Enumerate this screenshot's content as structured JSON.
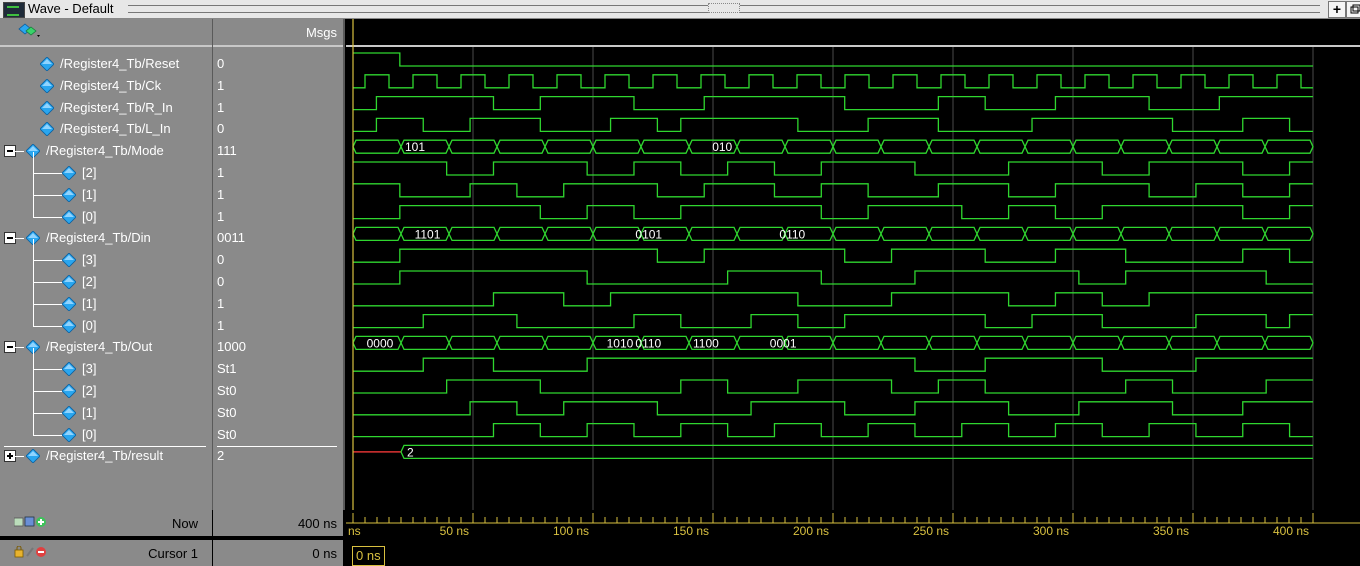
{
  "window": {
    "title": "Wave - Default",
    "buttons": [
      "+",
      ""
    ]
  },
  "header": {
    "msgs_label": "Msgs"
  },
  "signals": [
    {
      "name": "/Register4_Tb/Reset",
      "value": "0",
      "level": 0,
      "expand": null,
      "type": "bit",
      "wave": [
        1,
        1,
        0,
        0,
        0,
        0,
        0,
        0,
        0,
        0,
        0,
        0,
        0,
        0,
        0,
        0,
        0,
        0,
        0,
        0,
        0,
        0,
        0,
        0,
        0,
        0,
        0,
        0,
        0,
        0,
        0,
        0,
        0,
        0,
        0,
        0,
        0,
        0,
        0,
        0,
        0
      ]
    },
    {
      "name": "/Register4_Tb/Ck",
      "value": "1",
      "level": 0,
      "expand": null,
      "type": "clock"
    },
    {
      "name": "/Register4_Tb/R_In",
      "value": "1",
      "level": 0,
      "expand": null,
      "type": "bit",
      "wave": [
        0,
        1,
        1,
        1,
        1,
        1,
        0,
        0,
        1,
        1,
        1,
        1,
        0,
        0,
        0,
        1,
        1,
        1,
        1,
        1,
        1,
        0,
        0,
        0,
        0,
        1,
        1,
        0,
        0,
        0,
        1,
        1,
        1,
        1,
        0,
        0,
        0,
        1,
        1,
        1,
        1
      ]
    },
    {
      "name": "/Register4_Tb/L_In",
      "value": "0",
      "level": 0,
      "expand": null,
      "type": "bit",
      "wave": [
        0,
        1,
        1,
        0,
        0,
        1,
        1,
        1,
        0,
        0,
        0,
        1,
        1,
        0,
        1,
        1,
        1,
        1,
        1,
        0,
        0,
        0,
        1,
        1,
        1,
        0,
        0,
        0,
        0,
        1,
        1,
        1,
        1,
        1,
        1,
        0,
        0,
        0,
        1,
        1,
        0
      ]
    },
    {
      "name": "/Register4_Tb/Mode",
      "value": "111",
      "level": 0,
      "expand": "minus",
      "type": "bus",
      "labels": [
        {
          "at": 10,
          "text": "101"
        },
        {
          "at": 74,
          "text": "010"
        }
      ]
    },
    {
      "name": "[2]",
      "value": "1",
      "level": 1,
      "expand": null,
      "type": "bit",
      "wave": [
        1,
        1,
        1,
        1,
        0,
        0,
        1,
        1,
        1,
        1,
        0,
        0,
        1,
        1,
        0,
        0,
        1,
        1,
        0,
        0,
        1,
        1,
        1,
        1,
        0,
        0,
        0,
        0,
        1,
        1,
        1,
        1,
        0,
        0,
        1,
        1,
        1,
        1,
        0,
        0,
        1
      ]
    },
    {
      "name": "[1]",
      "value": "1",
      "level": 1,
      "expand": null,
      "type": "bit",
      "wave": [
        1,
        1,
        0,
        0,
        0,
        1,
        1,
        0,
        0,
        1,
        1,
        1,
        1,
        0,
        0,
        1,
        1,
        1,
        0,
        0,
        1,
        1,
        0,
        0,
        0,
        1,
        1,
        1,
        0,
        0,
        1,
        1,
        1,
        1,
        0,
        0,
        1,
        1,
        0,
        0,
        1
      ]
    },
    {
      "name": "[0]",
      "value": "1",
      "level": 1,
      "expand": null,
      "type": "bit",
      "wave": [
        0,
        0,
        1,
        1,
        1,
        1,
        1,
        1,
        0,
        0,
        1,
        1,
        0,
        0,
        1,
        1,
        1,
        1,
        1,
        1,
        0,
        0,
        1,
        1,
        1,
        1,
        0,
        0,
        1,
        1,
        0,
        0,
        1,
        1,
        1,
        1,
        1,
        1,
        0,
        0,
        1
      ]
    },
    {
      "name": "/Register4_Tb/Din",
      "value": "0011",
      "level": 0,
      "expand": "minus",
      "type": "bus",
      "labels": [
        {
          "at": 12,
          "text": "1101"
        },
        {
          "at": 58,
          "text": "0101"
        },
        {
          "at": 88,
          "text": "0110"
        }
      ]
    },
    {
      "name": "[3]",
      "value": "0",
      "level": 1,
      "expand": null,
      "type": "bit",
      "wave": [
        0,
        0,
        1,
        1,
        1,
        1,
        1,
        1,
        1,
        1,
        1,
        1,
        1,
        0,
        0,
        1,
        1,
        1,
        1,
        1,
        1,
        0,
        0,
        1,
        1,
        1,
        1,
        0,
        0,
        0,
        1,
        1,
        1,
        0,
        0,
        0,
        0,
        0,
        1,
        1,
        0
      ]
    },
    {
      "name": "[2]",
      "value": "0",
      "level": 1,
      "expand": null,
      "type": "bit",
      "wave": [
        0,
        0,
        1,
        1,
        1,
        1,
        1,
        1,
        1,
        1,
        0,
        0,
        0,
        0,
        0,
        0,
        1,
        1,
        1,
        1,
        0,
        0,
        0,
        0,
        1,
        1,
        1,
        1,
        1,
        1,
        1,
        0,
        0,
        1,
        1,
        1,
        1,
        1,
        1,
        0,
        0
      ]
    },
    {
      "name": "[1]",
      "value": "1",
      "level": 1,
      "expand": null,
      "type": "bit",
      "wave": [
        0,
        0,
        0,
        0,
        0,
        0,
        1,
        1,
        1,
        0,
        0,
        1,
        1,
        1,
        1,
        1,
        1,
        1,
        1,
        0,
        0,
        0,
        0,
        1,
        1,
        1,
        1,
        1,
        0,
        0,
        1,
        1,
        0,
        0,
        1,
        1,
        1,
        1,
        1,
        1,
        1
      ]
    },
    {
      "name": "[0]",
      "value": "1",
      "level": 1,
      "expand": null,
      "type": "bit",
      "wave": [
        0,
        0,
        0,
        1,
        1,
        1,
        1,
        0,
        0,
        0,
        0,
        0,
        1,
        1,
        0,
        0,
        0,
        1,
        1,
        0,
        0,
        1,
        1,
        1,
        1,
        1,
        1,
        0,
        0,
        1,
        1,
        1,
        0,
        0,
        0,
        0,
        1,
        1,
        1,
        0,
        1
      ]
    },
    {
      "name": "/Register4_Tb/Out",
      "value": "1000",
      "level": 0,
      "expand": "minus",
      "type": "bus",
      "labels": [
        {
          "at": 2,
          "text": "0000"
        },
        {
          "at": 58,
          "text": "0110"
        },
        {
          "at": 70,
          "text": "1100"
        },
        {
          "at": 52,
          "text": "1010"
        },
        {
          "at": 86,
          "text": "0001"
        }
      ]
    },
    {
      "name": "[3]",
      "value": "St1",
      "level": 1,
      "expand": null,
      "type": "bit",
      "wave": [
        0,
        0,
        0,
        1,
        1,
        1,
        0,
        0,
        0,
        0,
        1,
        1,
        1,
        1,
        1,
        1,
        1,
        1,
        1,
        1,
        1,
        1,
        1,
        1,
        0,
        0,
        0,
        1,
        1,
        1,
        1,
        1,
        0,
        0,
        0,
        0,
        1,
        1,
        1,
        1,
        1
      ]
    },
    {
      "name": "[2]",
      "value": "St0",
      "level": 1,
      "expand": null,
      "type": "bit",
      "wave": [
        0,
        0,
        0,
        0,
        1,
        1,
        1,
        1,
        0,
        0,
        0,
        0,
        0,
        0,
        1,
        1,
        0,
        0,
        0,
        1,
        1,
        1,
        1,
        0,
        0,
        1,
        1,
        0,
        0,
        0,
        0,
        0,
        0,
        1,
        1,
        0,
        0,
        0,
        0,
        1,
        1
      ]
    },
    {
      "name": "[1]",
      "value": "St0",
      "level": 1,
      "expand": null,
      "type": "bit",
      "wave": [
        0,
        0,
        0,
        0,
        0,
        1,
        1,
        0,
        0,
        1,
        1,
        1,
        1,
        0,
        0,
        0,
        0,
        1,
        1,
        1,
        1,
        0,
        0,
        0,
        1,
        1,
        1,
        1,
        0,
        0,
        0,
        1,
        1,
        1,
        1,
        0,
        0,
        0,
        1,
        1,
        1
      ]
    },
    {
      "name": "[0]",
      "value": "St0",
      "level": 1,
      "expand": null,
      "type": "bit",
      "wave": [
        0,
        0,
        0,
        0,
        0,
        0,
        1,
        1,
        0,
        0,
        1,
        1,
        0,
        0,
        1,
        1,
        0,
        0,
        1,
        1,
        0,
        0,
        1,
        1,
        0,
        0,
        1,
        1,
        0,
        0,
        1,
        1,
        0,
        0,
        1,
        1,
        0,
        0,
        1,
        1,
        0
      ]
    },
    {
      "name": "/Register4_Tb/result",
      "value": "2",
      "level": 0,
      "expand": "plus",
      "type": "result",
      "labels": [
        {
          "at": 5,
          "text": "2"
        }
      ]
    }
  ],
  "footer": {
    "now_label": "Now",
    "now_value": "400 ns",
    "cursor_label": "Cursor 1",
    "cursor_value": "0 ns",
    "cursor_box": "0 ns",
    "ticks": [
      "ns",
      "50 ns",
      "100 ns",
      "150 ns",
      "200 ns",
      "250 ns",
      "300 ns",
      "350 ns",
      "400 ns"
    ]
  },
  "colors": {
    "wave": "#2fd62f",
    "cursor": "#d8c040",
    "grid": "#4a4a4a",
    "result": "#d33"
  }
}
